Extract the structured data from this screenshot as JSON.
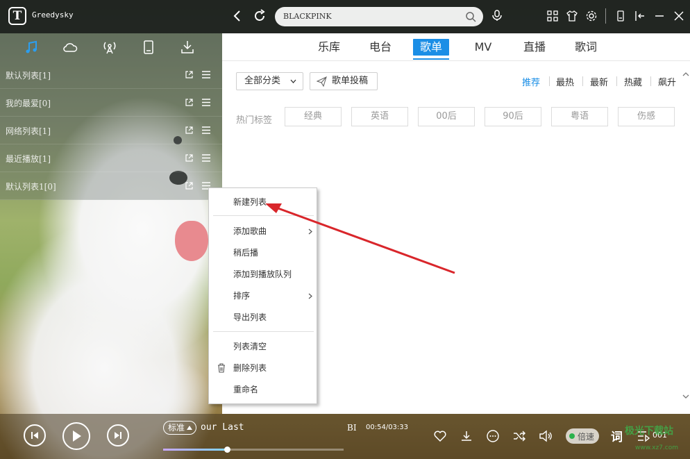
{
  "app": {
    "logo_letter": "T",
    "name": "Greedysky"
  },
  "search": {
    "query": "BLACKPINK"
  },
  "left_panel": {
    "playlists": [
      {
        "label": "默认列表[1]"
      },
      {
        "label": "我的最爱[0]"
      },
      {
        "label": "网络列表[1]"
      },
      {
        "label": "最近播放[1]"
      },
      {
        "label": "默认列表1[0]"
      }
    ]
  },
  "main": {
    "tabs": [
      {
        "label": "乐库"
      },
      {
        "label": "电台"
      },
      {
        "label": "歌单",
        "active": true
      },
      {
        "label": "MV"
      },
      {
        "label": "直播"
      },
      {
        "label": "歌词"
      }
    ],
    "category_button": "全部分类",
    "submit_button": "歌单投稿",
    "sort_options": [
      {
        "label": "推荐",
        "active": true
      },
      {
        "label": "最热"
      },
      {
        "label": "最新"
      },
      {
        "label": "热藏"
      },
      {
        "label": "飙升"
      }
    ],
    "hot_tags_label": "热门标签",
    "tags": [
      "经典",
      "英语",
      "00后",
      "90后",
      "粤语",
      "伤感"
    ]
  },
  "context_menu": {
    "items": [
      {
        "label": "新建列表"
      },
      {
        "label": "添加歌曲",
        "submenu": true
      },
      {
        "label": "稍后播"
      },
      {
        "label": "添加到播放队列"
      },
      {
        "label": "排序",
        "submenu": true
      },
      {
        "label": "导出列表"
      },
      {
        "label": "列表清空"
      },
      {
        "label": "删除列表"
      },
      {
        "label": "重命名"
      }
    ]
  },
  "player": {
    "quality": "标准",
    "song_title": "our Last",
    "artist": "BI",
    "time": "00:54/03:33",
    "progress": 0.355,
    "toggle_label": "倍速",
    "lyric_label": "词",
    "count": "001"
  },
  "watermark": {
    "text": "极光下载站",
    "sub": "www.xz7.com"
  },
  "colors": {
    "accent": "#1a8ee6",
    "annotation": "#d9262b"
  }
}
